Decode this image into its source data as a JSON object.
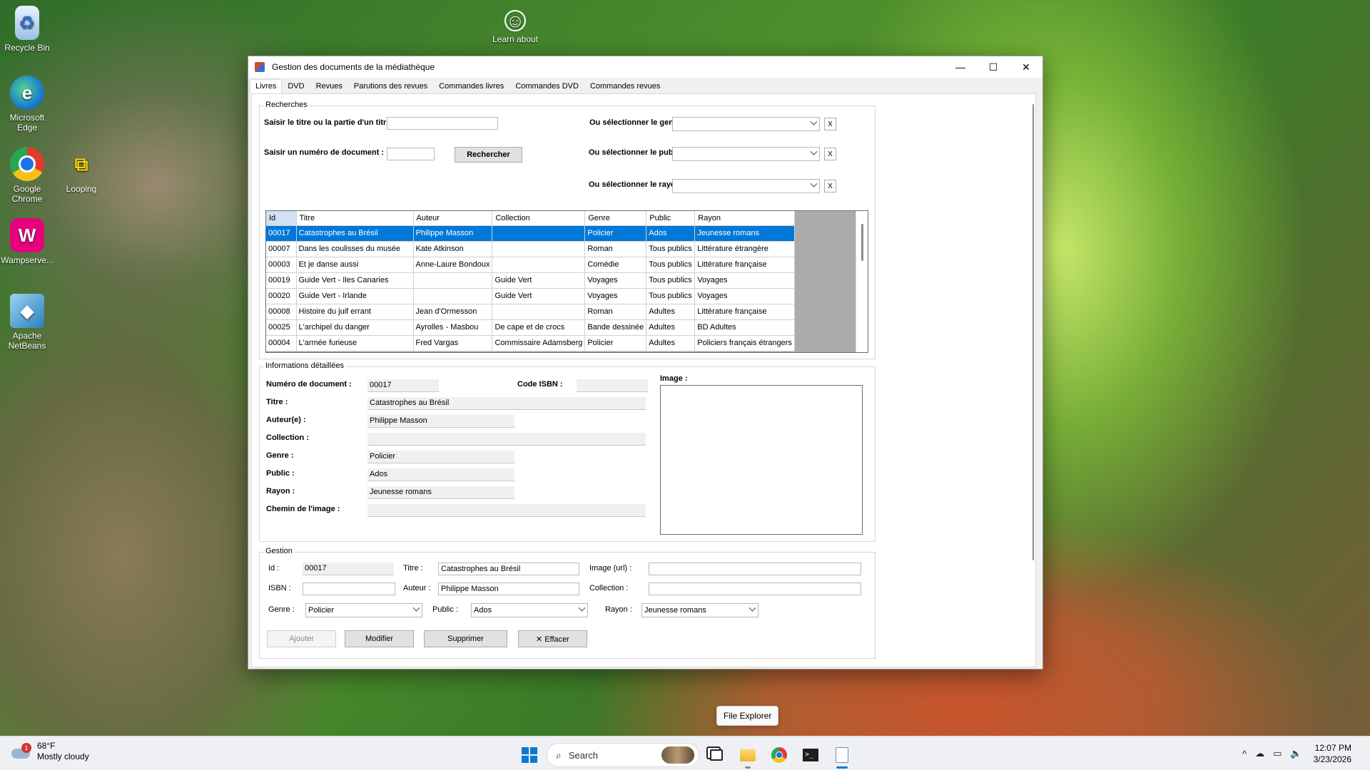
{
  "desktop": {
    "icons": [
      {
        "label": "Recycle Bin"
      },
      {
        "label": "Microsoft Edge"
      },
      {
        "label": "Google Chrome"
      },
      {
        "label": "Looping"
      },
      {
        "label": "Wampserve..."
      },
      {
        "label": "Apache NetBeans"
      },
      {
        "label": "Learn about"
      }
    ]
  },
  "window": {
    "title": "Gestion des documents de la médiathèque",
    "controls": {
      "minimize": "—",
      "maximize": "☐",
      "close": "✕"
    },
    "tabs": [
      "Livres",
      "DVD",
      "Revues",
      "Parutions des revues",
      "Commandes livres",
      "Commandes DVD",
      "Commandes revues"
    ]
  },
  "recherches": {
    "legend": "Recherches",
    "titre_label": "Saisir le titre ou la partie d'un titre :",
    "titre_value": "",
    "numero_label": "Saisir un numéro de document :",
    "numero_value": "",
    "rechercher_button": "Rechercher",
    "genre_label": "Ou sélectionner le genre :",
    "public_label": "Ou sélectionner le public :",
    "rayon_label": "Ou sélectionner le rayon :",
    "clear_button": "X"
  },
  "grid": {
    "columns": [
      "Id",
      "Titre",
      "Auteur",
      "Collection",
      "Genre",
      "Public",
      "Rayon"
    ],
    "rows": [
      [
        "00017",
        "Catastrophes au Brésil",
        "Philippe Masson",
        "",
        "Policier",
        "Ados",
        "Jeunesse romans"
      ],
      [
        "00007",
        "Dans les coulisses du musée",
        "Kate Atkinson",
        "",
        "Roman",
        "Tous publics",
        "Littérature étrangère"
      ],
      [
        "00003",
        "Et je danse aussi",
        "Anne-Laure Bondoux",
        "",
        "Comédie",
        "Tous publics",
        "Littérature française"
      ],
      [
        "00019",
        "Guide Vert - Iles Canaries",
        "",
        "Guide Vert",
        "Voyages",
        "Tous publics",
        "Voyages"
      ],
      [
        "00020",
        "Guide Vert - Irlande",
        "",
        "Guide Vert",
        "Voyages",
        "Tous publics",
        "Voyages"
      ],
      [
        "00008",
        "Histoire du juif errant",
        "Jean d'Ormesson",
        "",
        "Roman",
        "Adultes",
        "Littérature française"
      ],
      [
        "00025",
        "L'archipel du danger",
        "Ayrolles - Masbou",
        "De cape et de crocs",
        "Bande dessinée",
        "Adultes",
        "BD Adultes"
      ],
      [
        "00004",
        "L'armée furieuse",
        "Fred Vargas",
        "Commissaire Adamsberg",
        "Policier",
        "Adultes",
        "Policiers français étrangers"
      ]
    ],
    "selected_row": 0
  },
  "details": {
    "legend": "Informations détaillées",
    "numero_label": "Numéro de document :",
    "numero_value": "00017",
    "isbn_label": "Code ISBN :",
    "isbn_value": "",
    "image_label": "Image :",
    "titre_label": "Titre :",
    "titre_value": "Catastrophes au Brésil",
    "auteur_label": "Auteur(e) :",
    "auteur_value": "Philippe Masson",
    "collection_label": "Collection :",
    "collection_value": "",
    "genre_label": "Genre :",
    "genre_value": "Policier",
    "public_label": "Public :",
    "public_value": "Ados",
    "rayon_label": "Rayon :",
    "rayon_value": "Jeunesse romans",
    "chemin_label": "Chemin de l'image :",
    "chemin_value": ""
  },
  "gestion": {
    "legend": "Gestion",
    "id_label": "Id :",
    "id_value": "00017",
    "titre_label": "Titre :",
    "titre_value": "Catastrophes au Brésil",
    "image_label": "Image (url) :",
    "image_value": "",
    "isbn_label": "ISBN :",
    "isbn_value": "",
    "auteur_label": "Auteur :",
    "auteur_value": "Philippe Masson",
    "collection_label": "Collection :",
    "collection_value": "",
    "genre_label": "Genre :",
    "genre_value": "Policier",
    "public_label": "Public :",
    "public_value": "Ados",
    "rayon_label": "Rayon :",
    "rayon_value": "Jeunesse romans",
    "ajouter_button": "Ajouter",
    "modifier_button": "Modifier",
    "supprimer_button": "Supprimer",
    "effacer_button": "✕ Effacer"
  },
  "tooltip": "File Explorer",
  "taskbar": {
    "weather_temp": "68°F",
    "weather_desc": "Mostly cloudy",
    "weather_badge": "1",
    "search_placeholder": "Search",
    "time": "12:07 PM",
    "date": "3/23/2026"
  },
  "colors": {
    "selection": "#0078d7",
    "accent": "#0a78d4"
  }
}
